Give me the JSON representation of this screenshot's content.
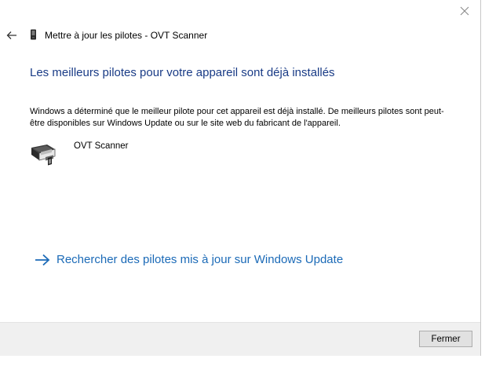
{
  "window": {
    "title": "Mettre à jour les pilotes - OVT Scanner"
  },
  "main": {
    "heading": "Les meilleurs pilotes pour votre appareil sont déjà installés",
    "description": "Windows a déterminé que le meilleur pilote pour cet appareil est déjà installé. De meilleurs pilotes sont peut-être disponibles sur Windows Update ou sur le site web du fabricant de l'appareil.",
    "device_name": "OVT Scanner",
    "update_link": "Rechercher des pilotes mis à jour sur Windows Update"
  },
  "footer": {
    "close_label": "Fermer"
  },
  "icons": {
    "close": "close-icon",
    "back": "back-arrow-icon",
    "title_device": "device-icon",
    "scanner": "scanner-icon",
    "link_arrow": "arrow-right-icon"
  },
  "colors": {
    "heading": "#193b86",
    "link": "#1b6ab7",
    "footer_bg": "#f0f0f0"
  }
}
